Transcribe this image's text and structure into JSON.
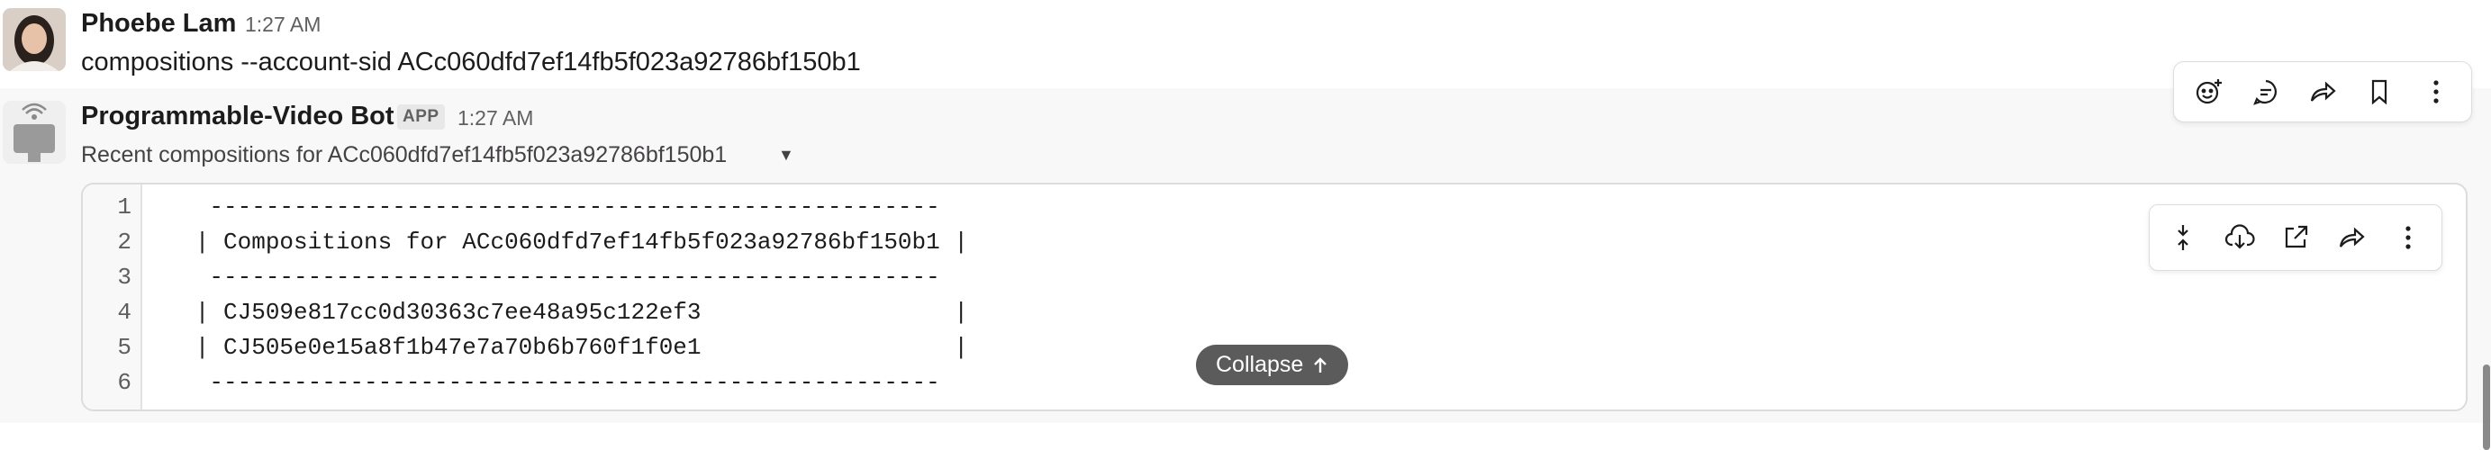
{
  "messages": [
    {
      "author": "Phoebe Lam",
      "time": "1:27 AM",
      "text": "compositions --account-sid ACc060dfd7ef14fb5f023a92786bf150b1"
    },
    {
      "author": "Programmable-Video Bot",
      "badge": "APP",
      "time": "1:27 AM",
      "subtitle": "Recent compositions for ACc060dfd7ef14fb5f023a92786bf150b1"
    }
  ],
  "code": {
    "line_numbers": [
      "1",
      "2",
      "3",
      "4",
      "5",
      "6"
    ],
    "lines": [
      "    ----------------------------------------------------",
      "   | Compositions for ACc060dfd7ef14fb5f023a92786bf150b1 |",
      "    ----------------------------------------------------",
      "   | CJ509e817cc0d30363c7ee48a95c122ef3                  |",
      "   | CJ505e0e15a8f1b47e7a70b6b760f1f0e1                  |",
      "    ----------------------------------------------------"
    ],
    "collapse_label": "Collapse"
  },
  "icons": {
    "message_actions": [
      "add-reaction-icon",
      "reply-thread-icon",
      "forward-icon",
      "bookmark-icon",
      "more-icon"
    ],
    "code_actions": [
      "collapse-icon",
      "download-icon",
      "open-external-icon",
      "share-icon",
      "more-icon"
    ]
  }
}
